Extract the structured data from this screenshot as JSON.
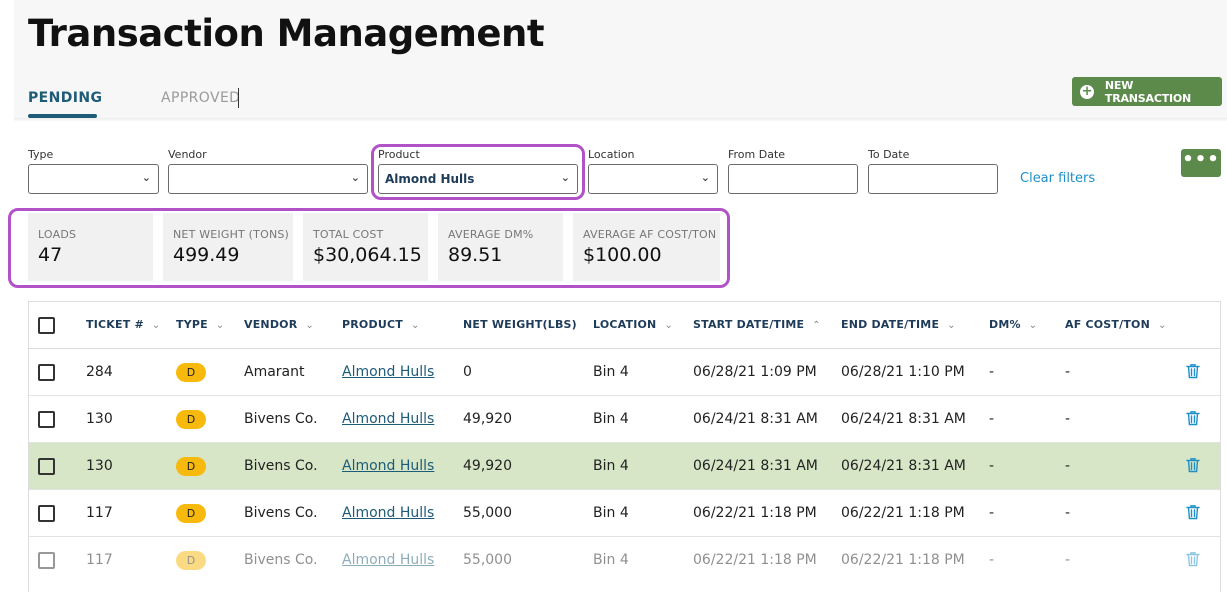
{
  "page": {
    "title": "Transaction Management"
  },
  "tabs": [
    {
      "label": "PENDING",
      "active": true
    },
    {
      "label": "APPROVED",
      "active": false
    }
  ],
  "new_transaction_button": {
    "label": "NEW TRANSACTION",
    "icon": "plus-circle-icon",
    "color": "#5b8a4a"
  },
  "filters": {
    "type": {
      "label": "Type",
      "value": ""
    },
    "vendor": {
      "label": "Vendor",
      "value": ""
    },
    "product": {
      "label": "Product",
      "value": "Almond Hulls"
    },
    "location": {
      "label": "Location",
      "value": ""
    },
    "from_date": {
      "label": "From Date",
      "value": ""
    },
    "to_date": {
      "label": "To Date",
      "value": ""
    },
    "clear_label": "Clear filters"
  },
  "more_button": {
    "label": "•••",
    "icon": "more-horizontal-icon"
  },
  "stats": [
    {
      "label": "LOADS",
      "value": "47"
    },
    {
      "label": "NET WEIGHT (TONS)",
      "value": "499.49"
    },
    {
      "label": "TOTAL COST",
      "value": "$30,064.15"
    },
    {
      "label": "AVERAGE DM%",
      "value": "89.51"
    },
    {
      "label": "AVERAGE AF COST/TON",
      "value": "$100.00"
    }
  ],
  "table": {
    "columns": [
      {
        "label": "TICKET #",
        "sort": "⌄"
      },
      {
        "label": "TYPE",
        "sort": "⌄"
      },
      {
        "label": "VENDOR",
        "sort": "⌄"
      },
      {
        "label": "PRODUCT",
        "sort": "⌄"
      },
      {
        "label": "NET WEIGHT(LBS)",
        "sort": ""
      },
      {
        "label": "LOCATION",
        "sort": "⌄"
      },
      {
        "label": "START DATE/TIME",
        "sort": "⌃"
      },
      {
        "label": "END DATE/TIME",
        "sort": "⌄"
      },
      {
        "label": "DM%",
        "sort": "⌄"
      },
      {
        "label": "AF COST/TON",
        "sort": "⌄"
      }
    ],
    "rows": [
      {
        "ticket": "284",
        "type": "D",
        "vendor": "Amarant",
        "product": "Almond Hulls",
        "net_weight": "0",
        "location": "Bin 4",
        "start": "06/28/21 1:09 PM",
        "end": "06/28/21 1:10 PM",
        "dm": "-",
        "af_cost": "-",
        "state": "normal"
      },
      {
        "ticket": "130",
        "type": "D",
        "vendor": "Bivens Co.",
        "product": "Almond Hulls",
        "net_weight": "49,920",
        "location": "Bin 4",
        "start": "06/24/21 8:31 AM",
        "end": "06/24/21 8:31 AM",
        "dm": "-",
        "af_cost": "-",
        "state": "normal"
      },
      {
        "ticket": "130",
        "type": "D",
        "vendor": "Bivens Co.",
        "product": "Almond Hulls",
        "net_weight": "49,920",
        "location": "Bin 4",
        "start": "06/24/21 8:31 AM",
        "end": "06/24/21 8:31 AM",
        "dm": "-",
        "af_cost": "-",
        "state": "selected"
      },
      {
        "ticket": "117",
        "type": "D",
        "vendor": "Bivens Co.",
        "product": "Almond Hulls",
        "net_weight": "55,000",
        "location": "Bin 4",
        "start": "06/22/21 1:18 PM",
        "end": "06/22/21 1:18 PM",
        "dm": "-",
        "af_cost": "-",
        "state": "normal"
      },
      {
        "ticket": "117",
        "type": "D",
        "vendor": "Bivens Co.",
        "product": "Almond Hulls",
        "net_weight": "55,000",
        "location": "Bin 4",
        "start": "06/22/21 1:18 PM",
        "end": "06/22/21 1:18 PM",
        "dm": "-",
        "af_cost": "-",
        "state": "faded"
      }
    ]
  },
  "colors": {
    "accent": "#1e5b78",
    "button_green": "#5b8a4a",
    "highlight": "#b153c6",
    "selected_row": "#d6e6c6",
    "badge": "#f7b90b",
    "link": "#1f8fc8"
  }
}
